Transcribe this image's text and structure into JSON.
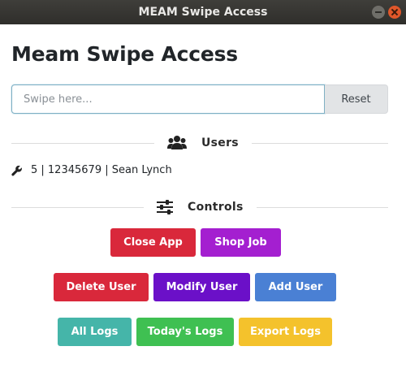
{
  "window": {
    "title": "MEAM Swipe Access"
  },
  "page": {
    "heading": "Meam Swipe Access"
  },
  "swipe": {
    "placeholder": "Swipe here...",
    "value": "",
    "reset_label": "Reset"
  },
  "users_section": {
    "label": "Users",
    "icon": "users-icon",
    "entries": [
      {
        "icon": "wrench-icon",
        "text": "5 | 12345679 | Sean Lynch"
      }
    ]
  },
  "controls_section": {
    "label": "Controls",
    "icon": "sliders-icon"
  },
  "buttons": {
    "close_app": {
      "label": "Close App",
      "color": "#d9283b"
    },
    "shop_job": {
      "label": "Shop Job",
      "color": "#a41fd0"
    },
    "delete_user": {
      "label": "Delete User",
      "color": "#d9283b"
    },
    "modify_user": {
      "label": "Modify User",
      "color": "#6b10c8"
    },
    "add_user": {
      "label": "Add User",
      "color": "#4a80d4"
    },
    "all_logs": {
      "label": "All Logs",
      "color": "#45b5a9"
    },
    "todays_logs": {
      "label": "Today's Logs",
      "color": "#3fc052"
    },
    "export_logs": {
      "label": "Export Logs",
      "color": "#f4c22c"
    }
  },
  "colors": {
    "titlebar": "#35342f",
    "close_window": "#e0572a",
    "input_border": "#7fb0c4"
  }
}
